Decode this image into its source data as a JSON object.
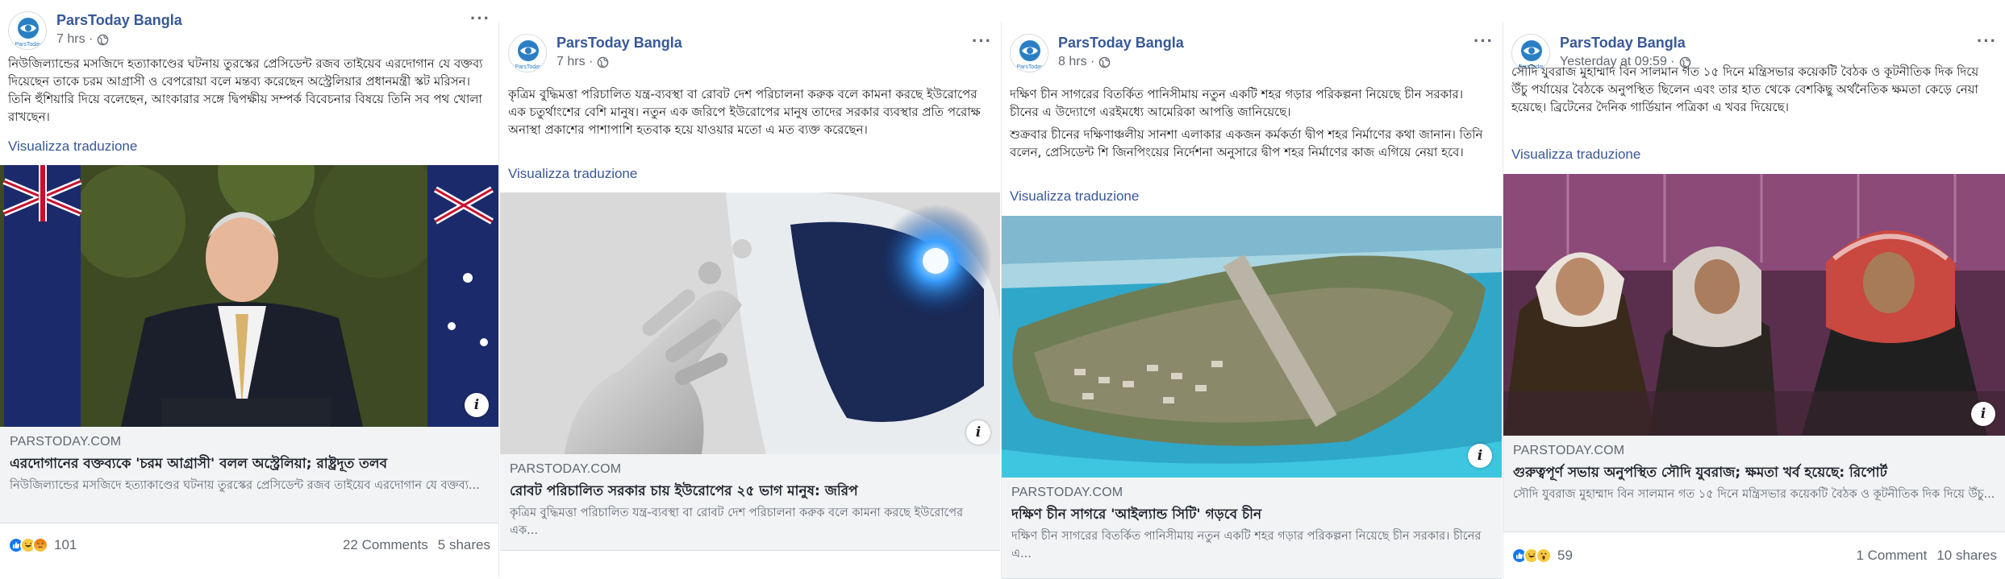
{
  "page_name": "ParsToday Bangla",
  "translate_label": "Visualizza traduzione",
  "posts": [
    {
      "time": "7 hrs ·",
      "body": [
        "নিউজিল্যান্ডের মসজিদে হত্যাকাণ্ডের ঘটনায় তুরস্কের প্রেসিডেন্ট রজব তাইয়েব এরদোগান যে বক্তব্য দিয়েছেন তাকে চরম আগ্রাসী ও বেপরোয়া বলে মন্তব্য করেছেন অস্ট্রেলিয়ার প্রধানমন্ত্রী স্কট মরিসন। তিনি হুঁশিয়ারি দিয়ে বলেছেন, আংকারার সঙ্গে দ্বিপক্ষীয় সম্পর্ক বিবেচনার বিষয়ে তিনি সব পথ খোলা রাখছেন।"
      ],
      "domain": "PARSTODAY.COM",
      "link_title": "এরদোগানের বক্তব্যকে 'চরম আগ্রাসী' বলল অস্ট্রেলিয়া; রাষ্ট্রদূত তলব",
      "link_desc": "নিউজিল্যান্ডের মসজিদে হত্যাকাণ্ডের ঘটনায় তুরস্কের প্রেসিডেন্ট রজব তাইয়েব এরদোগান যে বক্তব্য...",
      "reaction_count": "101",
      "reactions": [
        "like",
        "haha",
        "angry"
      ],
      "comments": "22 Comments",
      "shares": "5 shares"
    },
    {
      "time": "7 hrs ·",
      "body": [
        "কৃত্রিম বুদ্ধিমত্তা পরিচালিত যন্ত্র-ব্যবস্থা বা রোবট দেশ পরিচালনা করুক বলে কামনা করছে ইউরোপের এক চতুর্থাংশের বেশি মানুষ। নতুন এক জরিপে ইউরোপের মানুষ তাদের সরকার ব্যবস্থার প্রতি পরোক্ষ অনাস্থা প্রকাশের পাশাপাশি হতবাক হয়ে যাওয়ার মতো এ মত ব্যক্ত করেছেন।"
      ],
      "domain": "PARSTODAY.COM",
      "link_title": "রোবট পরিচালিত সরকার চায় ইউরোপের ২৫ ভাগ মানুষ: জরিপ",
      "link_desc": "কৃত্রিম বুদ্ধিমত্তা পরিচালিত যন্ত্র-ব্যবস্থা বা রোবট দেশ পরিচালনা করুক বলে কামনা করছে ইউরোপের এক..."
    },
    {
      "time": "8 hrs ·",
      "body": [
        "দক্ষিণ চীন সাগরের বিতর্কিত পানিসীমায় নতুন একটি শহর গড়ার পরিকল্পনা নিয়েছে চীন সরকার। চীনের এ উদ্যোগে এরইমধ্যে আমেরিকা আপত্তি জানিয়েছে।",
        "শুক্রবার চীনের দক্ষিণাঞ্চলীয় সানশা এলাকার একজন কর্মকর্তা দ্বীপ শহর নির্মাণের কথা জানান। তিনি বলেন, প্রেসিডেন্ট শি জিনপিংয়ের নির্দেশনা অনুসারে দ্বীপ শহর নির্মাণের কাজ এগিয়ে নেয়া হবে।"
      ],
      "domain": "PARSTODAY.COM",
      "link_title": "দক্ষিণ চীন সাগরে 'আইল্যান্ড সিটি' গড়বে চীন",
      "link_desc": "দক্ষিণ চীন সাগরের বিতর্কিত পানিসীমায় নতুন একটি শহর গড়ার পরিকল্পনা নিয়েছে চীন সরকার। চীনের এ..."
    },
    {
      "time": "Yesterday at 09:59 ·",
      "body": [
        "সৌদি যুবরাজ মুহাম্মাদ বিন সালমান গত ১৫ দিনে মন্ত্রিসভার কয়েকটি বৈঠক ও কূটনীতিক দিক দিয়ে উঁচু পর্যায়ের বৈঠকে অনুপস্থিত ছিলেন এবং তার হাত থেকে বেশকিছু অর্থনৈতিক ক্ষমতা কেড়ে নেয়া হয়েছে। ব্রিটেনের দৈনিক গার্ডিয়ান পত্রিকা এ খবর দিয়েছে।"
      ],
      "domain": "PARSTODAY.COM",
      "link_title": "গুরুত্বপূর্ণ সভায় অনুপস্থিত সৌদি যুবরাজ; ক্ষমতা খর্ব হয়েছে: রিপোর্ট",
      "link_desc": "সৌদি যুবরাজ মুহাম্মাদ বিন সালমান গত ১৫ দিনে মন্ত্রিসভার কয়েকটি বৈঠক ও কূটনীতিক দিক দিয়ে উঁচু...",
      "reaction_count": "59",
      "reactions": [
        "like",
        "haha",
        "wow"
      ],
      "comments": "1 Comment",
      "shares": "10 shares"
    }
  ],
  "colors": {
    "link_blue": "#385898",
    "meta_gray": "#606770",
    "link_box_bg": "#f2f3f5",
    "like_blue": "#1877f2"
  },
  "icons": [
    "logo-avatar",
    "globe-icon",
    "more-options-icon",
    "info-icon",
    "like-icon",
    "haha-icon",
    "angry-icon",
    "wow-icon"
  ]
}
